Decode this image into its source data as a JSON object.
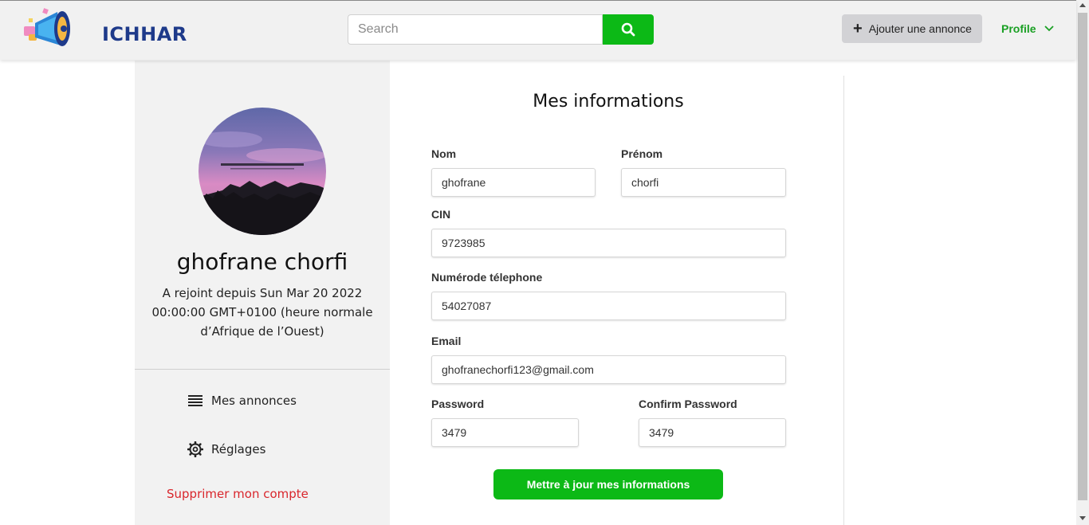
{
  "header": {
    "logo_text": "ICHHAR",
    "search_placeholder": "Search",
    "search_icon": "search-icon",
    "add_button_label": "Ajouter une annonce",
    "profile_label": "Profile"
  },
  "colors": {
    "accent_green": "#0cb916",
    "danger_red": "#d9262c",
    "panel_gray": "#f2f2f2"
  },
  "sidebar": {
    "user_name": "ghofrane chorfi",
    "joined_text": "A rejoint depuis Sun Mar 20 2022 00:00:00 GMT+0100 (heure normale d’Afrique de l’Ouest)",
    "menu": [
      {
        "label": "Mes annonces",
        "icon": "list-icon"
      },
      {
        "label": "Réglages",
        "icon": "gear-icon"
      }
    ],
    "delete_label": "Supprimer mon compte"
  },
  "form": {
    "title": "Mes informations",
    "nom_label": "Nom",
    "nom_value": "ghofrane",
    "prenom_label": "Prénom",
    "prenom_value": "chorfi",
    "cin_label": "CIN",
    "cin_value": "9723985",
    "phone_label": "Numérode télephone",
    "phone_value": "54027087",
    "email_label": "Email",
    "email_value": "ghofranechorfi123@gmail.com",
    "password_label": "Password",
    "password_value": "3479",
    "confirm_label": "Confirm Password",
    "confirm_value": "3479",
    "submit_label": "Mettre à jour mes informations"
  }
}
